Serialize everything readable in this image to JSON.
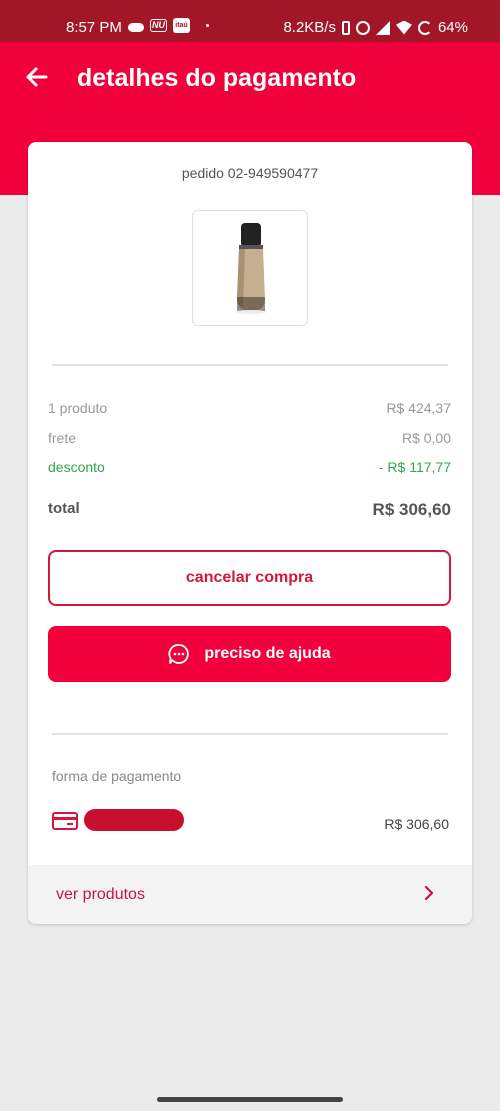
{
  "status_bar": {
    "time": "8:57 PM",
    "nu_label": "NU",
    "itau_label": "itaú",
    "network_speed": "8.2KB/s",
    "battery": "64%"
  },
  "header": {
    "title": "detalhes do pagamento"
  },
  "order": {
    "id_text": "pedido 02-949590477"
  },
  "summary": {
    "products_label": "1 produto",
    "products_value": "R$ 424,37",
    "shipping_label": "frete",
    "shipping_value": "R$ 0,00",
    "discount_label": "desconto",
    "discount_value": "- R$ 117,77",
    "total_label": "total",
    "total_value": "R$ 306,60"
  },
  "actions": {
    "cancel_label": "cancelar compra",
    "help_label": "preciso de ajuda"
  },
  "payment": {
    "label": "forma de pagamento",
    "value": "R$ 306,60"
  },
  "footer": {
    "products_link": "ver produtos"
  },
  "colors": {
    "brand": "#f2003c",
    "status_bar": "#a31628",
    "discount": "#2ea84a",
    "link": "#c2174a"
  },
  "icons": [
    "back-arrow-icon",
    "chat-bubble-icon",
    "credit-card-icon",
    "chevron-right-icon"
  ]
}
